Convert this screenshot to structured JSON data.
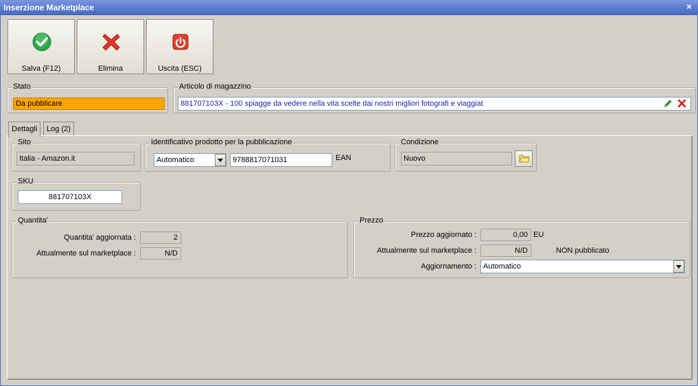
{
  "window": {
    "title": "Inserzione Marketplace",
    "close_glyph": "×"
  },
  "toolbar": {
    "save_label": "Salva (F12)",
    "delete_label": "Elimina",
    "exit_label": "Uscita (ESC)"
  },
  "stato": {
    "title": "Stato",
    "value": "Da pubblicare",
    "color": "#ffa500"
  },
  "articolo": {
    "title": "Articolo di magazzino",
    "value": "881707103X - 100 spiagge da vedere nella vita scelte dai nostri migliori fotografi e viaggiat",
    "edit_icon": "pencil-icon",
    "remove_icon": "red-x-icon"
  },
  "tabs": [
    {
      "label": "Dettagli",
      "active": true
    },
    {
      "label": "Log (2)",
      "active": false
    }
  ],
  "sito": {
    "title": "Sito",
    "value": "Italia - Amazon.it"
  },
  "identificativo": {
    "title": "Identificativo prodotto per la pubblicazione",
    "type_value": "Automatico",
    "code_value": "9788817071031",
    "code_type": "EAN"
  },
  "condizione": {
    "title": "Condizione",
    "value": "Nuovo",
    "icon": "folder-icon"
  },
  "sku": {
    "title": "SKU",
    "value": "881707103X"
  },
  "quantita": {
    "title": "Quantita'",
    "updated_label": "Quantita' aggiornata :",
    "updated_value": "2",
    "market_label": "Attualmente sul marketplace :",
    "market_value": "N/D"
  },
  "prezzo": {
    "title": "Prezzo",
    "updated_label": "Prezzo aggiornato :",
    "updated_value": "0,00",
    "currency": "EU",
    "market_label": "Attualmente sul marketplace :",
    "market_value": "N/D",
    "status_text": "NON pubblicato",
    "aggiornamento_label": "Aggiornamento :",
    "aggiornamento_value": "Automatico"
  }
}
